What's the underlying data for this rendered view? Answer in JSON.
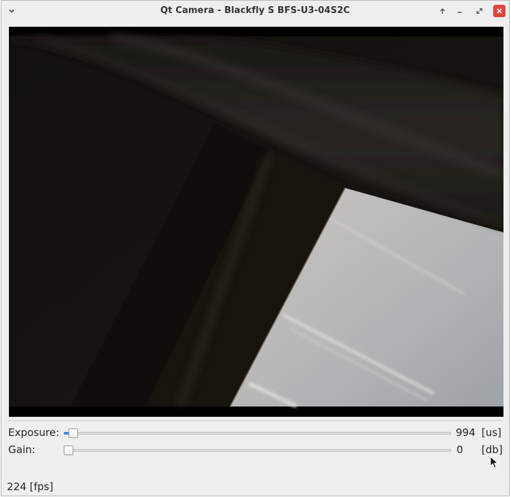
{
  "window": {
    "title": "Qt Camera - Blackfly S BFS-U3-04S2C"
  },
  "titlebar_buttons": [
    {
      "name": "window-menu",
      "icon": "chevron-down-icon"
    },
    {
      "name": "keep-above",
      "icon": "arrow-up-icon"
    },
    {
      "name": "minimize",
      "icon": "minimize-icon"
    },
    {
      "name": "maximize",
      "icon": "maximize-icon"
    },
    {
      "name": "close",
      "icon": "close-icon"
    }
  ],
  "controls": {
    "exposure": {
      "label": "Exposure:",
      "value": "994",
      "unit": "[us]",
      "slider_fraction": 0.012
    },
    "gain": {
      "label": "Gain:",
      "value": "0",
      "unit": "[db]",
      "slider_fraction": 0.0
    }
  },
  "status": {
    "fps": "224 [fps]"
  },
  "colors": {
    "close_button": "#e0453c",
    "slider_accent": "#3b8ee0",
    "window_background": "#efefef"
  }
}
